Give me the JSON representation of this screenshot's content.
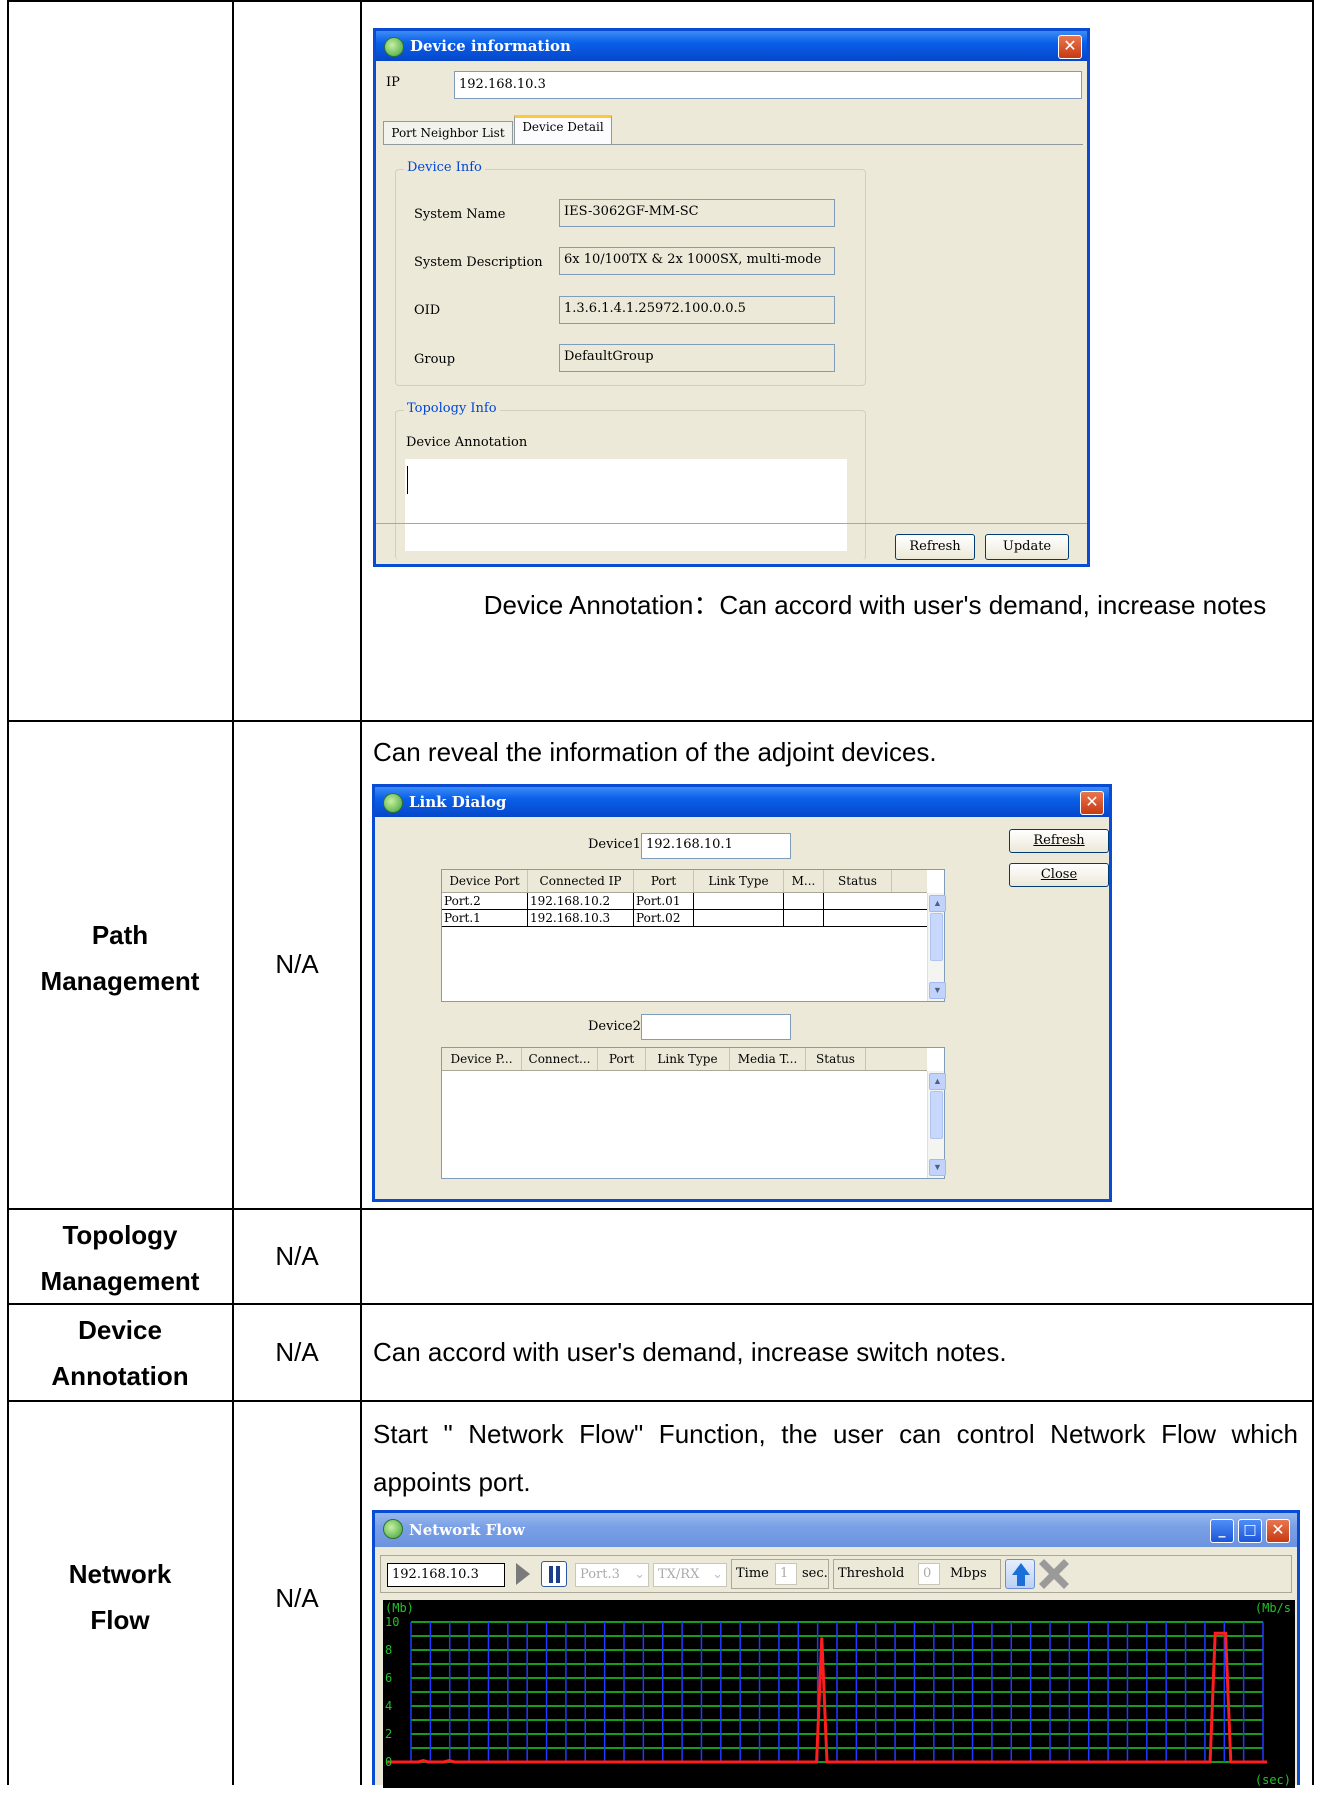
{
  "rows": [
    {
      "name": "",
      "value": "",
      "caption": "Device Annotation：Can accord with user's demand, increase notes"
    },
    {
      "name": "Path Management",
      "value": "N/A",
      "description": "Can reveal the information of the adjoint devices."
    },
    {
      "name": "Topology Management",
      "value": "N/A",
      "description": ""
    },
    {
      "name": "Device Annotation",
      "value": "N/A",
      "description": "Can accord with user's demand, increase switch notes."
    },
    {
      "name": "Network Flow",
      "value": "N/A",
      "description": "Start \" Network Flow\"  Function, the user can control Network Flow which appoints port."
    }
  ],
  "device_info_window": {
    "title": "Device information",
    "ip_label": "IP",
    "ip_value": "192.168.10.3",
    "tabs": [
      "Port Neighbor List",
      "Device Detail"
    ],
    "device_info_group": "Device Info",
    "fields": [
      {
        "label": "System Name",
        "value": "IES-3062GF-MM-SC"
      },
      {
        "label": "System Description",
        "value": "6x 10/100TX & 2x 1000SX, multi-mode"
      },
      {
        "label": "OID",
        "value": "1.3.6.1.4.1.25972.100.0.0.5"
      },
      {
        "label": "Group",
        "value": "DefaultGroup"
      }
    ],
    "topology_group": "Topology Info",
    "annotation_label": "Device Annotation",
    "refresh_label": "Refresh",
    "update_label": "Update"
  },
  "link_dialog": {
    "title": "Link Dialog",
    "device1_label": "Device1",
    "device1_value": "192.168.10.1",
    "device2_label": "Device2",
    "device2_value": "",
    "refresh_label": "Refresh",
    "close_label": "Close",
    "table1_headers": [
      "Device Port",
      "Connected IP",
      "Port",
      "Link Type",
      "M...",
      "Status"
    ],
    "table1_rows": [
      [
        "Port.2",
        "192.168.10.2",
        "Port.01",
        "",
        "",
        ""
      ],
      [
        "Port.1",
        "192.168.10.3",
        "Port.02",
        "",
        "",
        ""
      ]
    ],
    "table2_headers": [
      "Device P...",
      "Connect...",
      "Port",
      "Link Type",
      "Media T...",
      "Status"
    ]
  },
  "network_flow_window": {
    "title": "Network Flow",
    "ip_value": "192.168.10.3",
    "port_value": "Port.3",
    "direction_value": "TX/RX",
    "time_label": "Time",
    "time_value": "1",
    "sec_label": "sec.",
    "threshold_label": "Threshold",
    "threshold_value": "0",
    "mbps_label": "Mbps",
    "chart_left_unit": "(Mb)",
    "chart_right_unit": "(Mb/s",
    "chart_x_unit": "(sec)",
    "y_ticks": [
      "10",
      "8",
      "6",
      "4",
      "2",
      "0"
    ],
    "colors": {
      "background": "#000000",
      "grid_h": "#1fd01f",
      "grid_v": "#1e3cff",
      "line": "#ff1e1e",
      "text": "#22c12a"
    }
  },
  "chart_data": {
    "type": "line",
    "ylabel": "(Mb)",
    "xlabel": "(sec)",
    "ylim": [
      0,
      10
    ],
    "series": [
      {
        "values": [
          0,
          0,
          0,
          0,
          0,
          0,
          0,
          0.1,
          0,
          0,
          0,
          0,
          0.1,
          0,
          0,
          0,
          0,
          0,
          0,
          0,
          0,
          0,
          0,
          0,
          0,
          0,
          0,
          0,
          0,
          0,
          0,
          0,
          0,
          0,
          0,
          0,
          0,
          0,
          0,
          0,
          0,
          0,
          0,
          0,
          0,
          0,
          0,
          0,
          0,
          0,
          0,
          0,
          0,
          0,
          0,
          0,
          0,
          0,
          0,
          0,
          0,
          0,
          0,
          0,
          0,
          0,
          0,
          0,
          0,
          0,
          0,
          0,
          0,
          0,
          0,
          0,
          0,
          0,
          0,
          0,
          0,
          0,
          0,
          0,
          8.9,
          0,
          0,
          0,
          0,
          0,
          0,
          0,
          0,
          0,
          0,
          0,
          0,
          0,
          0,
          0,
          0,
          0,
          0,
          0,
          0,
          0,
          0,
          0,
          0,
          0,
          0,
          0,
          0,
          0,
          0,
          0,
          0,
          0,
          0,
          0,
          0,
          0,
          0,
          0,
          0,
          0,
          0,
          0,
          0,
          0,
          0,
          0,
          0,
          0,
          0,
          0,
          0,
          0,
          0,
          0,
          0,
          0,
          0,
          0,
          0,
          0,
          0,
          0,
          0,
          0,
          0,
          0,
          0,
          0,
          0,
          0,
          0,
          0,
          0,
          0,
          9.2,
          9.2,
          9.2,
          0,
          0,
          0,
          0,
          0,
          0,
          0,
          0
        ]
      }
    ]
  }
}
